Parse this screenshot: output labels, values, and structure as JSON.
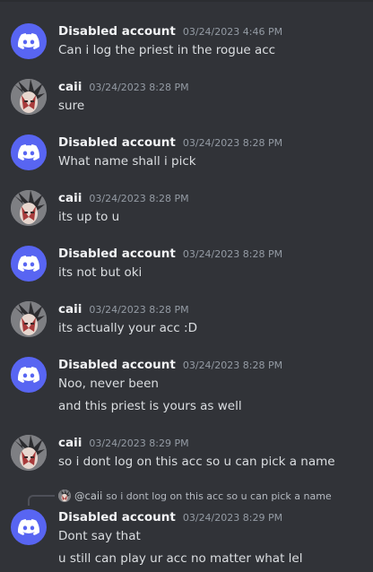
{
  "colors": {
    "background": "#313338",
    "discord_blurple": "#5865f2",
    "author": "#f2f3f5",
    "timestamp": "#949ba4",
    "text": "#dbdee1"
  },
  "icons": {
    "discord_avatar": "discord-logo-icon",
    "user_avatar": "anime-character-avatar"
  },
  "messages": [
    {
      "author": "Disabled account",
      "time": "03/24/2023 4:46 PM",
      "lines": [
        "Can i log the priest in the rogue acc"
      ]
    },
    {
      "author": "caii",
      "time": "03/24/2023 8:28 PM",
      "lines": [
        "sure"
      ]
    },
    {
      "author": "Disabled account",
      "time": "03/24/2023 8:28 PM",
      "lines": [
        "What name shall i  pick"
      ]
    },
    {
      "author": "caii",
      "time": "03/24/2023 8:28 PM",
      "lines": [
        "its up to u"
      ]
    },
    {
      "author": "Disabled account",
      "time": "03/24/2023 8:28 PM",
      "lines": [
        "its not but oki"
      ]
    },
    {
      "author": "caii",
      "time": "03/24/2023 8:28 PM",
      "lines": [
        "its actually your acc :D"
      ]
    },
    {
      "author": "Disabled account",
      "time": "03/24/2023 8:28 PM",
      "lines": [
        "Noo, never been",
        "and this priest is yours as well"
      ]
    },
    {
      "author": "caii",
      "time": "03/24/2023 8:29 PM",
      "lines": [
        "so i dont log on this acc so u can pick a name"
      ]
    },
    {
      "author": "Disabled account",
      "time": "03/24/2023 8:29 PM",
      "lines": [
        "Dont say that",
        "u still can play ur acc no matter what lel"
      ]
    }
  ],
  "reply": {
    "mention": "@caii",
    "text": "so i dont log on this acc so u can pick a name"
  }
}
